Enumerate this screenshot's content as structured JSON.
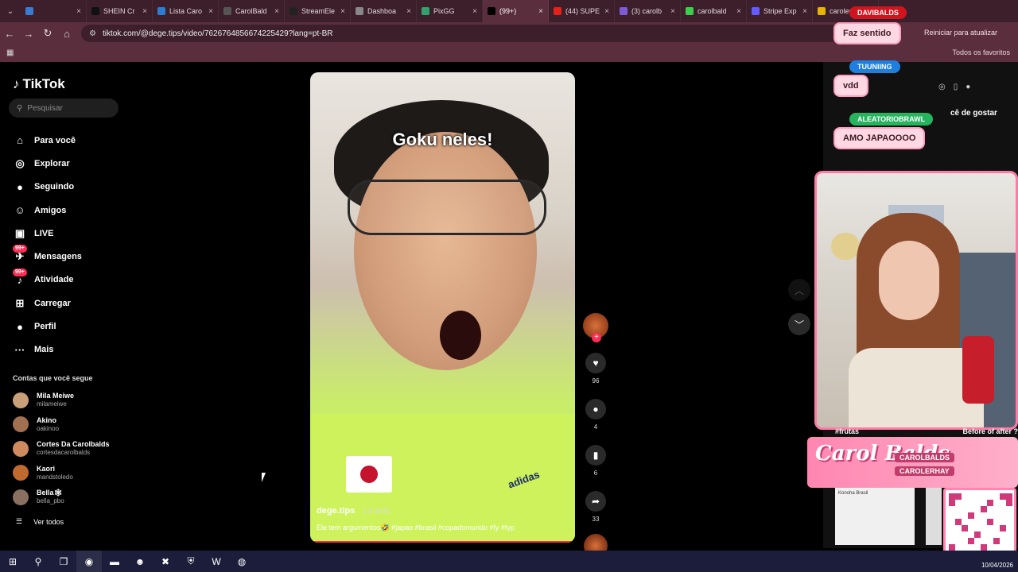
{
  "browser": {
    "tabs": [
      {
        "title": "",
        "color": "#3a7bd5",
        "active": false
      },
      {
        "title": "SHEIN Cr",
        "color": "#111111",
        "active": false
      },
      {
        "title": "Lista Caro",
        "color": "#2b7cd3",
        "active": false
      },
      {
        "title": "CarolBald",
        "color": "#555555",
        "active": false
      },
      {
        "title": "StreamEle",
        "color": "#222222",
        "active": false
      },
      {
        "title": "Dashboa",
        "color": "#888888",
        "active": false
      },
      {
        "title": "PixGG",
        "color": "#2fa36b",
        "active": false
      },
      {
        "title": "(99+)",
        "color": "#000000",
        "active": true
      },
      {
        "title": "(44) SUPE",
        "color": "#e62117",
        "active": false
      },
      {
        "title": "(3) carolb",
        "color": "#7b5cd6",
        "active": false
      },
      {
        "title": "carolbald",
        "color": "#3ccf4e",
        "active": false
      },
      {
        "title": "Stripe Exp",
        "color": "#635bff",
        "active": false
      },
      {
        "title": "carolerha",
        "color": "#e8b400",
        "active": false
      }
    ],
    "url": "tiktok.com/@dege.tips/video/7626764856674225429?lang=pt-BR",
    "restart_label": "Reiniciar para atualizar",
    "all_favorites": "Todos os favoritos"
  },
  "tiktok": {
    "logo": "TikTok",
    "search_placeholder": "Pesquisar",
    "nav": [
      {
        "label": "Para você",
        "icon": "home-icon",
        "glyph": "⌂"
      },
      {
        "label": "Explorar",
        "icon": "compass-icon",
        "glyph": "◎"
      },
      {
        "label": "Seguindo",
        "icon": "following-icon",
        "glyph": "●"
      },
      {
        "label": "Amigos",
        "icon": "friends-icon",
        "glyph": "☺"
      },
      {
        "label": "LIVE",
        "icon": "live-icon",
        "glyph": "▣"
      },
      {
        "label": "Mensagens",
        "icon": "messages-icon",
        "glyph": "✈",
        "badge": "99+"
      },
      {
        "label": "Atividade",
        "icon": "activity-icon",
        "glyph": "♪",
        "badge": "99+"
      },
      {
        "label": "Carregar",
        "icon": "upload-icon",
        "glyph": "⊞"
      },
      {
        "label": "Perfil",
        "icon": "profile-icon",
        "glyph": "●"
      },
      {
        "label": "Mais",
        "icon": "more-icon",
        "glyph": "···"
      }
    ],
    "following_title": "Contas que você segue",
    "accounts": [
      {
        "name": "Mila Meiwe",
        "handle": "milameiwe",
        "color": "#c9a07a"
      },
      {
        "name": "Akino",
        "handle": "oakinoo",
        "color": "#a07050"
      },
      {
        "name": "Cortes Da Carolbalds",
        "handle": "cortesdacarolbalds",
        "color": "#d08a60"
      },
      {
        "name": "Kaori",
        "handle": "mandstoledo",
        "color": "#c06a30"
      },
      {
        "name": "Bella🕸",
        "handle": "bella_pbo",
        "color": "#8a7060"
      }
    ],
    "see_all": "Ver todos"
  },
  "video": {
    "overlay": "Goku neles!",
    "username": "dege.tips",
    "age": "· 1 d atrás",
    "description": "Ele tem argumentos🤣 #japao #brasil #copadomundo #fy #fyp",
    "likes": "96",
    "comments": "4",
    "saves": "6",
    "shares": "33"
  },
  "stream_overlay": {
    "bubbles": [
      "Faz sentido",
      "vdd",
      "AMO JAPAOOOO"
    ],
    "tags": [
      "DAVIBALDS",
      "TUUNIING",
      "ALEATORIOBRAWL"
    ],
    "like_text": "cê de gostar",
    "row_tags": [
      "#frutas",
      "Before of after ?"
    ],
    "brand": "Carol Balds",
    "handles": [
      "CAROLBALDS",
      "CAROLERHAY"
    ],
    "thumb_text": "Konoha Brasil"
  },
  "taskbar": {
    "date": "10/04/2026"
  }
}
